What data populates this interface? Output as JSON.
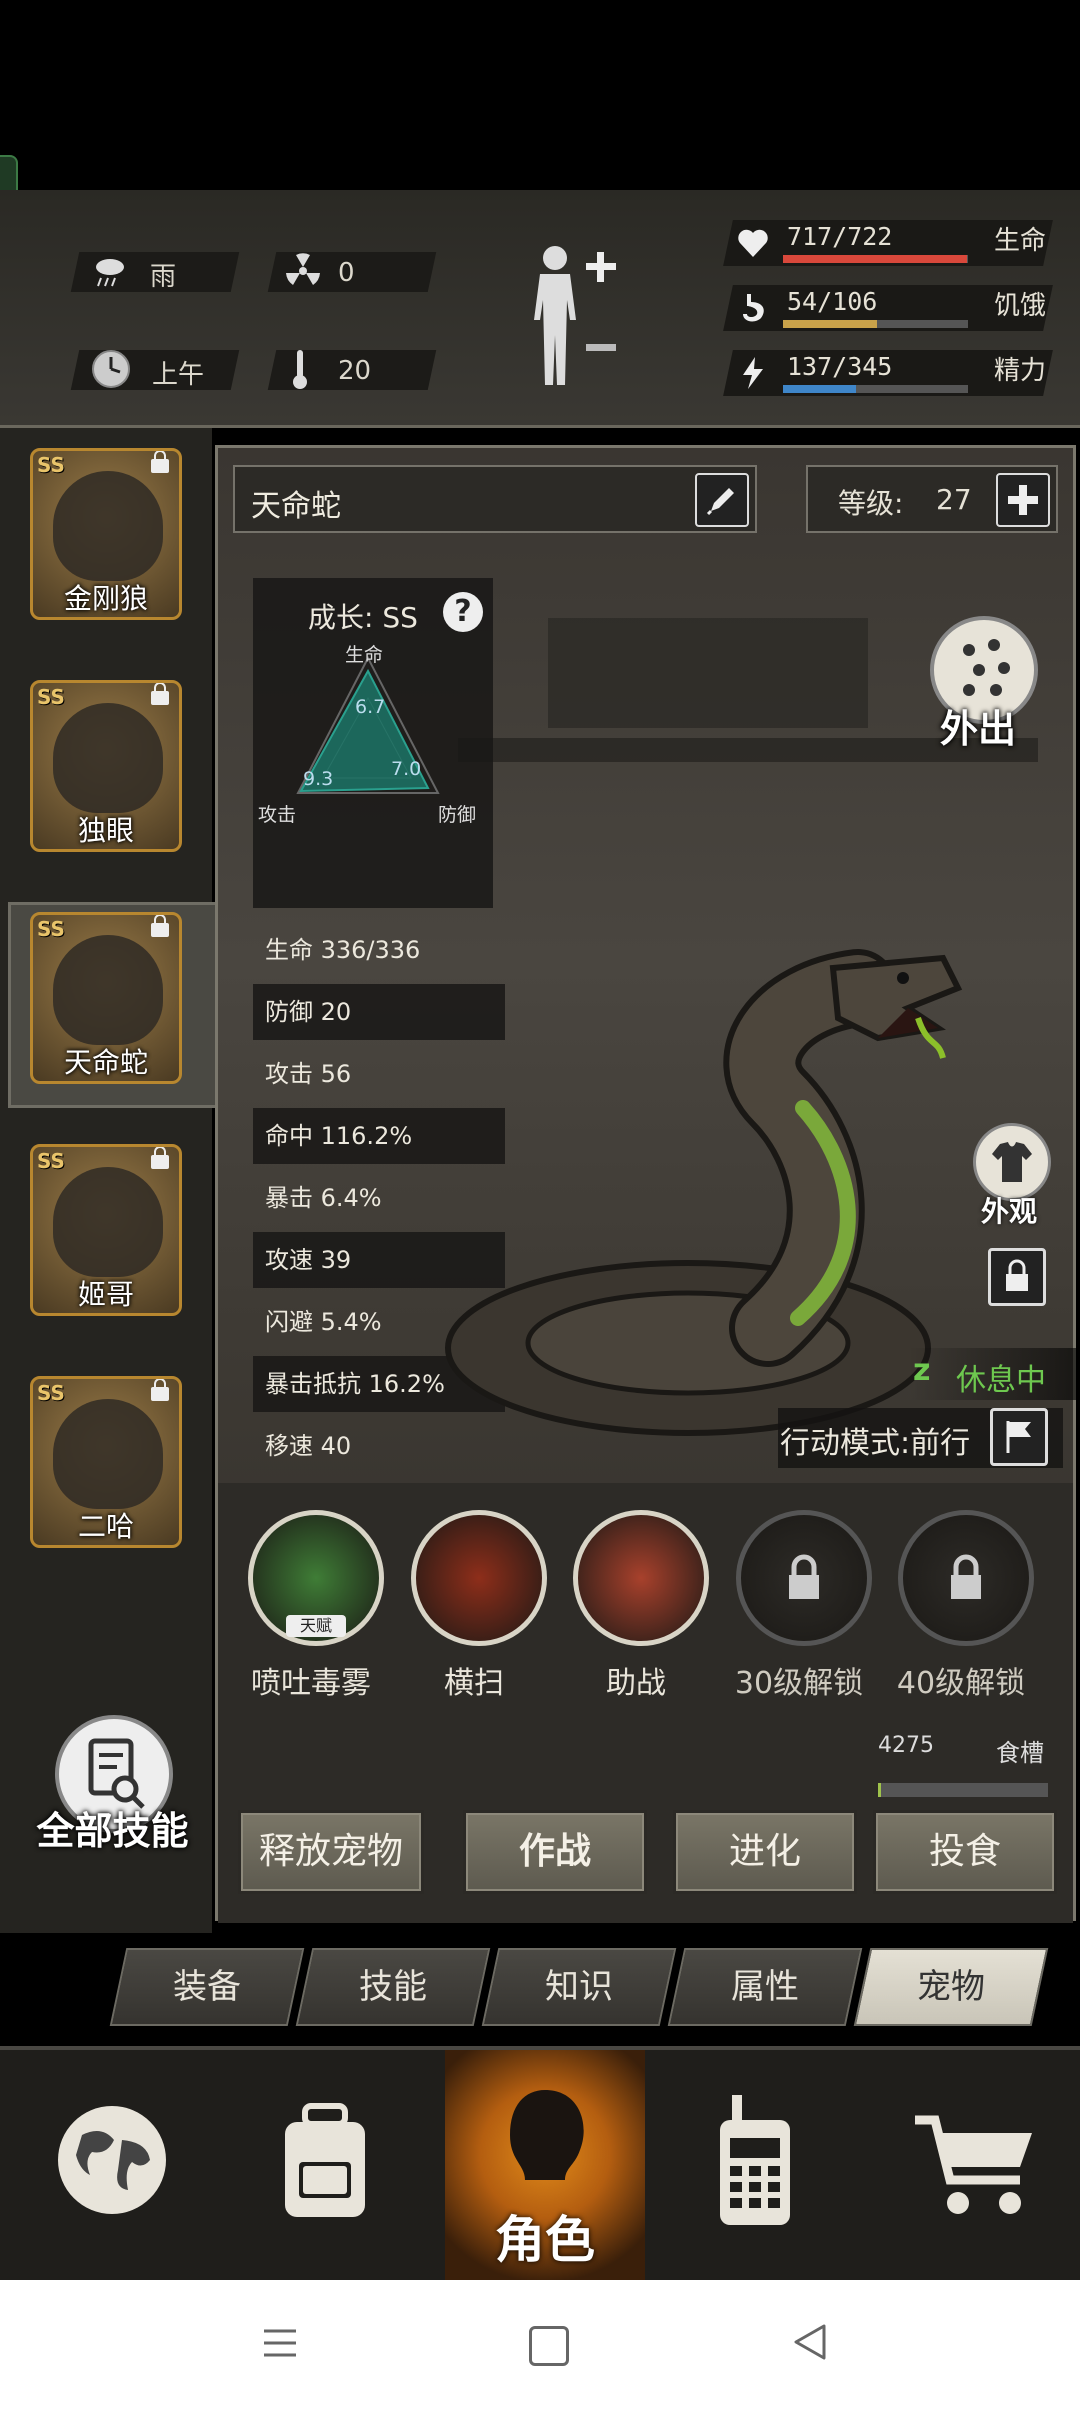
{
  "env": {
    "weather": "雨",
    "radiation": "0",
    "time": "上午",
    "temperature": "20"
  },
  "player_stats": [
    {
      "value": "717/722",
      "label": "生命",
      "fill": 0.993,
      "color": "#d9483b",
      "icon": "heart-icon"
    },
    {
      "value": "54/106",
      "label": "饥饿",
      "fill": 0.509,
      "color": "#c9a24a",
      "icon": "stomach-icon"
    },
    {
      "value": "137/345",
      "label": "精力",
      "fill": 0.397,
      "color": "#3f86c9",
      "icon": "energy-icon"
    }
  ],
  "pets": [
    {
      "name": "金刚狼",
      "rank": "SS",
      "locked": true,
      "selected": false
    },
    {
      "name": "独眼",
      "rank": "SS",
      "locked": true,
      "selected": false
    },
    {
      "name": "天命蛇",
      "rank": "SS",
      "locked": true,
      "selected": true
    },
    {
      "name": "姬哥",
      "rank": "SS",
      "locked": true,
      "selected": false
    },
    {
      "name": "二哈",
      "rank": "SS",
      "locked": true,
      "selected": false
    }
  ],
  "all_skills_label": "全部技能",
  "pet_detail": {
    "name": "天命蛇",
    "level_label": "等级:",
    "level": "27",
    "growth_label": "成长: SS",
    "radar": {
      "axes": [
        "生命",
        "攻击",
        "防御"
      ],
      "values": [
        "6.7",
        "9.3",
        "7.0"
      ]
    },
    "stats": [
      "生命 336/336",
      "防御 20",
      "攻击 56",
      "命中 116.2%",
      "暴击 6.4%",
      "攻速 39",
      "闪避 5.4%",
      "暴击抵抗 16.2%",
      "移速 40"
    ],
    "go_out_label": "外出",
    "appearance_label": "外观",
    "rest_status": "休息中",
    "action_mode": "行动模式:前行"
  },
  "skills": [
    {
      "label": "喷吐毒雾",
      "badge": "天赋",
      "locked": false,
      "color": "#3f7d36"
    },
    {
      "label": "横扫",
      "locked": false,
      "color": "#8e2e1a"
    },
    {
      "label": "助战",
      "locked": false,
      "color": "#a8412c"
    },
    {
      "label": "30级解锁",
      "locked": true,
      "color": "#2d2b27"
    },
    {
      "label": "40级解锁",
      "locked": true,
      "color": "#2d2b27"
    }
  ],
  "food": {
    "value": "4275",
    "label": "食槽",
    "fill": 0.02
  },
  "actions": [
    "释放宠物",
    "作战",
    "进化",
    "投食"
  ],
  "tabs": [
    {
      "label": "装备",
      "active": false
    },
    {
      "label": "技能",
      "active": false
    },
    {
      "label": "知识",
      "active": false
    },
    {
      "label": "属性",
      "active": false
    },
    {
      "label": "宠物",
      "active": true
    }
  ],
  "bottom_nav": [
    {
      "label": "",
      "icon": "globe-icon"
    },
    {
      "label": "",
      "icon": "backpack-icon"
    },
    {
      "label": "角色",
      "icon": "character-icon",
      "active": true
    },
    {
      "label": "",
      "icon": "walkie-talkie-icon"
    },
    {
      "label": "",
      "icon": "cart-icon"
    }
  ]
}
